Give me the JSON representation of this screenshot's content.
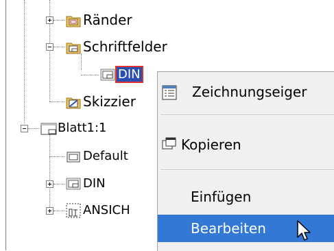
{
  "tree": {
    "items": [
      {
        "label": "Ränder",
        "icon": "folder-doc-icon"
      },
      {
        "label": "Schriftfelder",
        "icon": "folder-sheet-icon"
      },
      {
        "label": "DIN",
        "icon": "titleblock-icon",
        "selected": true
      },
      {
        "label": "Skizzier",
        "icon": "sketch-folder-icon"
      },
      {
        "label": "Blatt1:1",
        "icon": "sheet-icon"
      },
      {
        "label": "Default",
        "icon": "border-icon"
      },
      {
        "label": "DIN",
        "icon": "titleblock-icon"
      },
      {
        "label": "ANSICH",
        "icon": "view-icon"
      }
    ]
  },
  "context_menu": {
    "items": [
      {
        "label": "Zeichnungseiger",
        "icon": "properties-icon"
      },
      {
        "label": "Kopieren",
        "icon": "copy-icon"
      },
      {
        "label": "Einfügen"
      },
      {
        "label": "Bearbeiten",
        "highlighted": true
      }
    ]
  },
  "colors": {
    "selection": "#2a4fb0",
    "selection_border": "#e03030",
    "menu_highlight": "#3478d6",
    "menu_background": "#f0f0f0"
  }
}
